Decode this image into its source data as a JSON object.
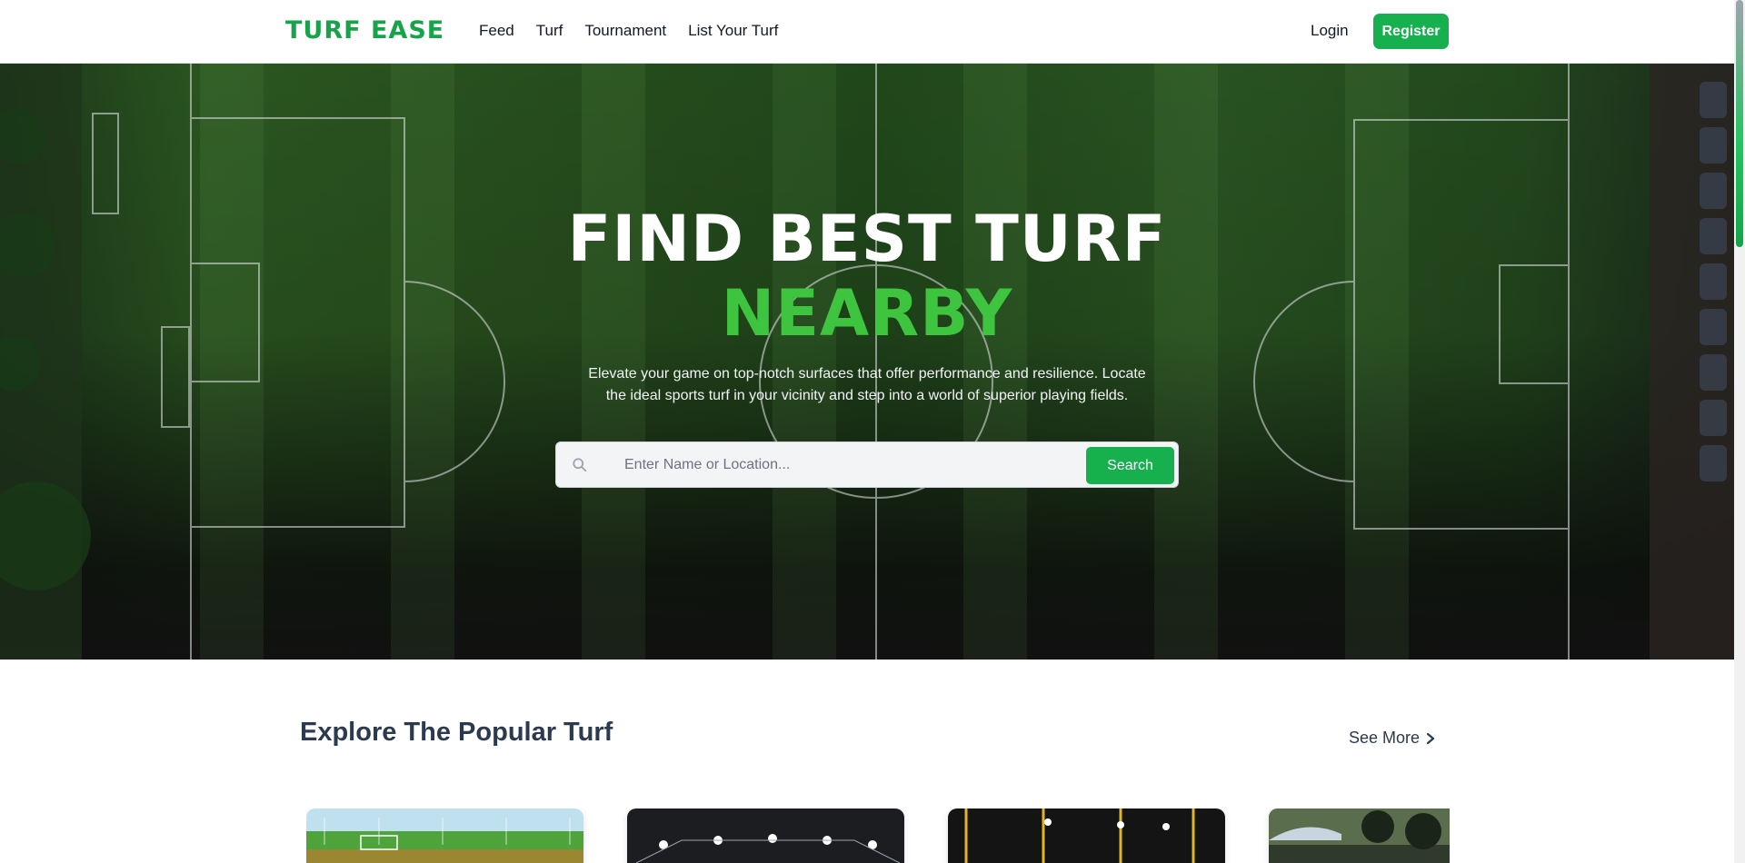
{
  "brand": {
    "logo": "TURF EASE",
    "accent": "#16b04f"
  },
  "nav": {
    "links": [
      "Feed",
      "Turf",
      "Tournament",
      "List Your Turf"
    ],
    "login": "Login",
    "register": "Register"
  },
  "hero": {
    "title_line1": "FIND BEST TURF",
    "title_line2": "NEARBY",
    "subtitle": "Elevate your game on top-notch surfaces that offer performance and resilience. Locate the ideal sports turf in your vicinity and step into a world of superior playing fields.",
    "search": {
      "placeholder": "Enter Name or Location...",
      "button": "Search",
      "icon": "search-icon"
    }
  },
  "popular": {
    "title": "Explore The Popular Turf",
    "see_more": "See More",
    "see_more_icon": "chevron-right-icon",
    "cards": [
      {
        "image": "turf-photo-daylight-field"
      },
      {
        "image": "turf-photo-night-floodlit"
      },
      {
        "image": "turf-photo-night-yellow-poles"
      },
      {
        "image": "turf-photo-outdoor-umbrella"
      }
    ]
  }
}
